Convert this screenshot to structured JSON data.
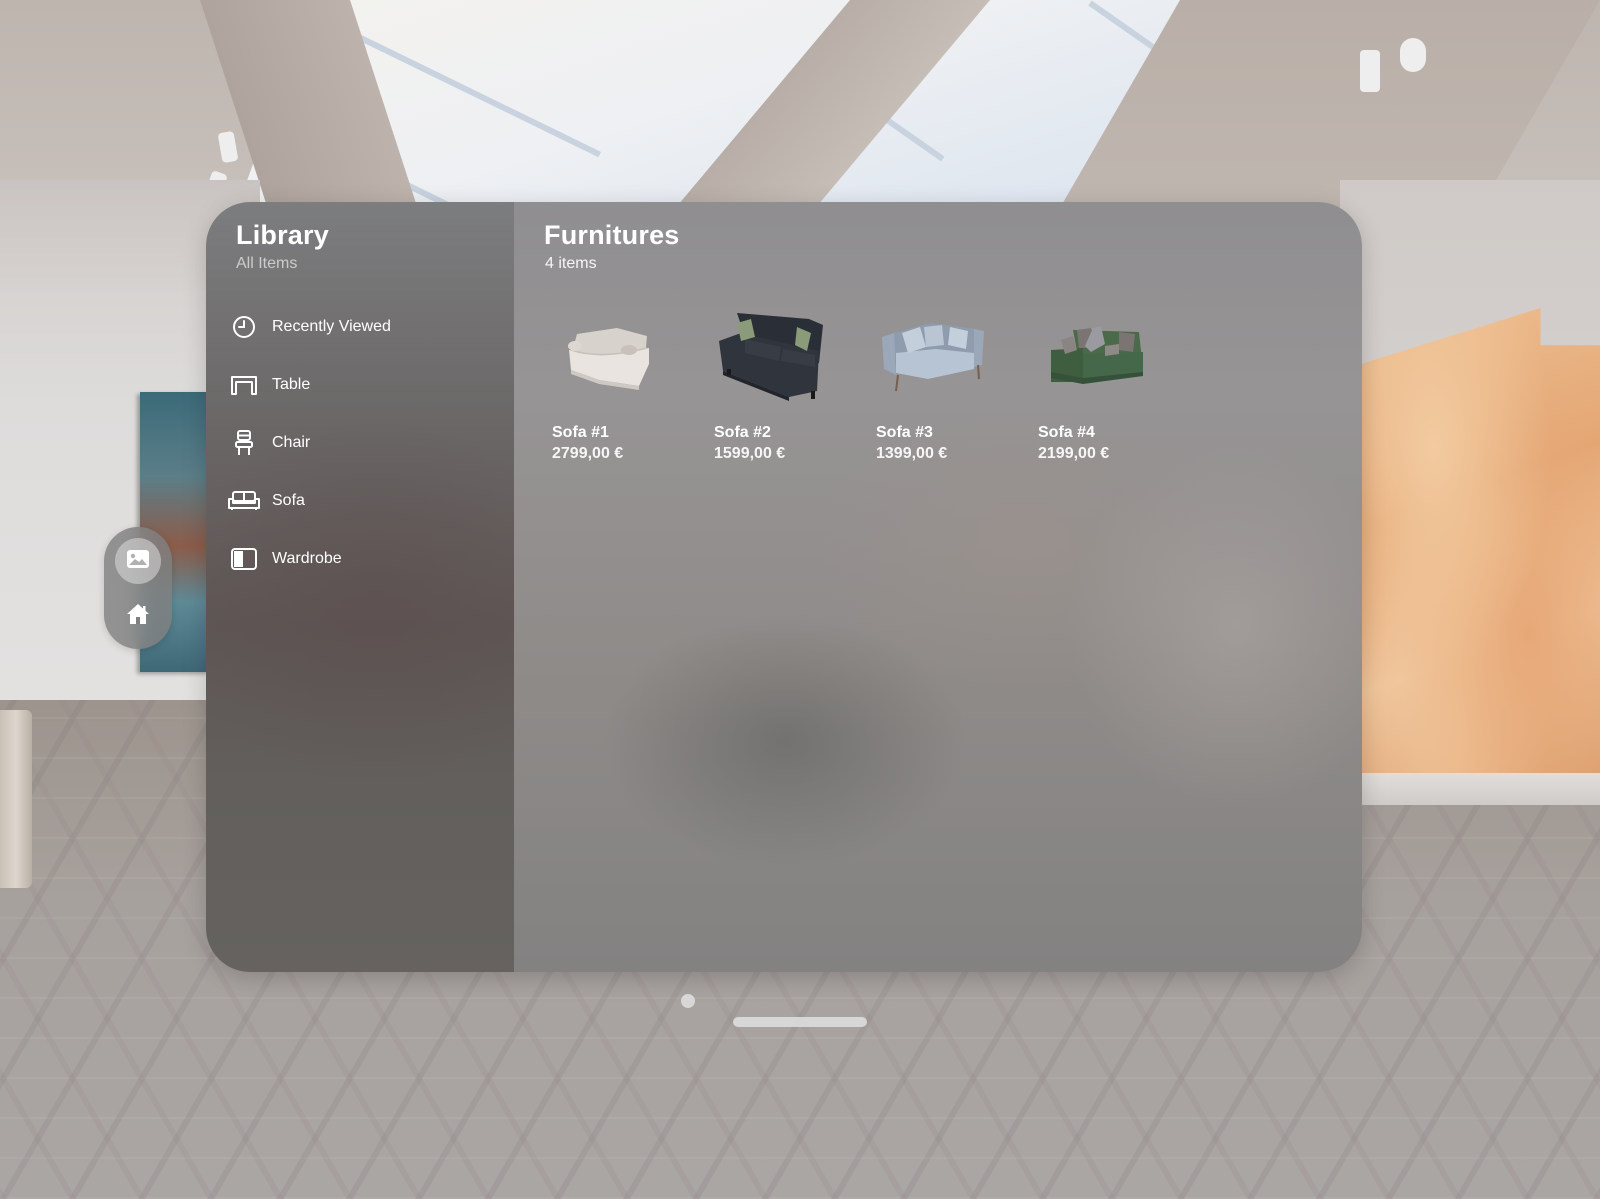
{
  "environment": {
    "description": "Virtual art gallery with skylight ceiling, paintings, marble sculpture and parquet floor"
  },
  "ornament": {
    "items": [
      {
        "id": "gallery",
        "icon": "photo-icon",
        "selected": true
      },
      {
        "id": "home",
        "icon": "house-icon",
        "selected": false
      }
    ]
  },
  "sidebar": {
    "title": "Library",
    "subtitle": "All Items",
    "items": [
      {
        "label": "Recently Viewed",
        "icon": "clock-icon"
      },
      {
        "label": "Table",
        "icon": "table-icon"
      },
      {
        "label": "Chair",
        "icon": "chair-icon"
      },
      {
        "label": "Sofa",
        "icon": "sofa-icon"
      },
      {
        "label": "Wardrobe",
        "icon": "wardrobe-icon"
      }
    ]
  },
  "content": {
    "title": "Furnitures",
    "count_label": "4 items",
    "products": [
      {
        "name": "Sofa #1",
        "price": "2799,00 €",
        "color": "#e6e0da",
        "style": "cream slipcover sofa"
      },
      {
        "name": "Sofa #2",
        "price": "1599,00 €",
        "color": "#2f333b",
        "style": "dark navy loveseat with patterned pillows"
      },
      {
        "name": "Sofa #3",
        "price": "1399,00 €",
        "color": "#a9b6c6",
        "style": "light blue-grey loveseat"
      },
      {
        "name": "Sofa #4",
        "price": "2199,00 €",
        "color": "#3f5e3f",
        "style": "green sectional with chaise"
      }
    ]
  },
  "window_controls": {
    "close": "window-close-dot",
    "move": "window-move-bar"
  }
}
